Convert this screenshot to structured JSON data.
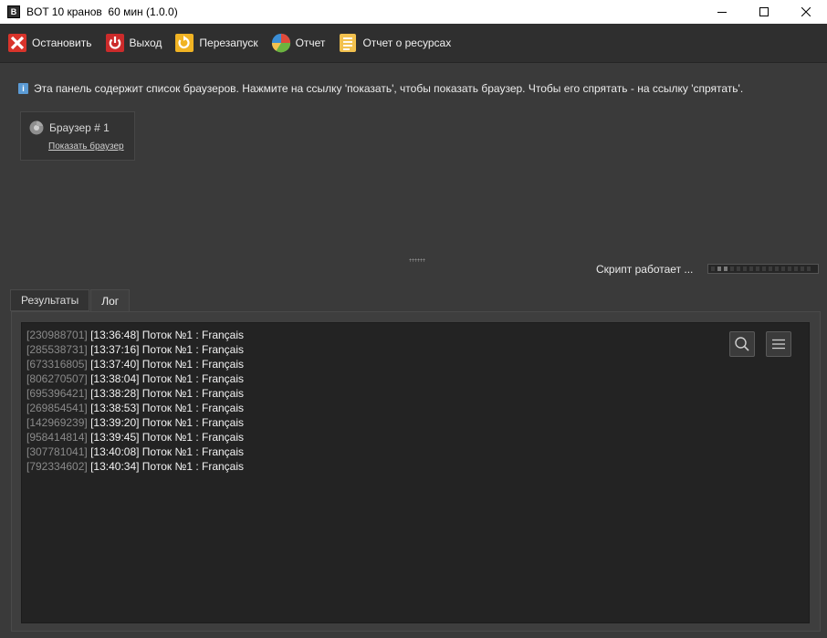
{
  "window": {
    "title": "BOT 10 кранов  60 мин (1.0.0)",
    "app_icon_letter": "B"
  },
  "toolbar": {
    "stop_label": "Остановить",
    "exit_label": "Выход",
    "restart_label": "Перезапуск",
    "report_label": "Отчет",
    "resources_label": "Отчет о ресурсах"
  },
  "info": {
    "text": "Эта панель содержит список браузеров. Нажмите на ссылку 'показать', чтобы показать браузер. Чтобы его спрятать - на ссылку 'спрятать'."
  },
  "browser": {
    "title": "Браузер # 1",
    "show_link": "Показать браузер"
  },
  "status": {
    "text": "Скрипт работает ..."
  },
  "tabs": [
    {
      "label": "Результаты"
    },
    {
      "label": "Лог"
    }
  ],
  "log": [
    {
      "id": "[230988701]",
      "msg": "[13:36:48] Поток №1 : Français"
    },
    {
      "id": "[285538731]",
      "msg": "[13:37:16] Поток №1 : Français"
    },
    {
      "id": "[673316805]",
      "msg": "[13:37:40] Поток №1 : Français"
    },
    {
      "id": "[806270507]",
      "msg": "[13:38:04] Поток №1 : Français"
    },
    {
      "id": "[695396421]",
      "msg": "[13:38:28] Поток №1 : Français"
    },
    {
      "id": "[269854541]",
      "msg": "[13:38:53] Поток №1 : Français"
    },
    {
      "id": "[142969239]",
      "msg": "[13:39:20] Поток №1 : Français"
    },
    {
      "id": "[958414814]",
      "msg": "[13:39:45] Поток №1 : Français"
    },
    {
      "id": "[307781041]",
      "msg": "[13:40:08] Поток №1 : Français"
    },
    {
      "id": "[792334602]",
      "msg": "[13:40:34] Поток №1 : Français"
    }
  ],
  "colors": {
    "background": "#3a3a3a",
    "log_background": "#232323",
    "stop_red": "#d9342b",
    "exit_red": "#cc2b2b",
    "restart_yellow": "#f0b323"
  }
}
